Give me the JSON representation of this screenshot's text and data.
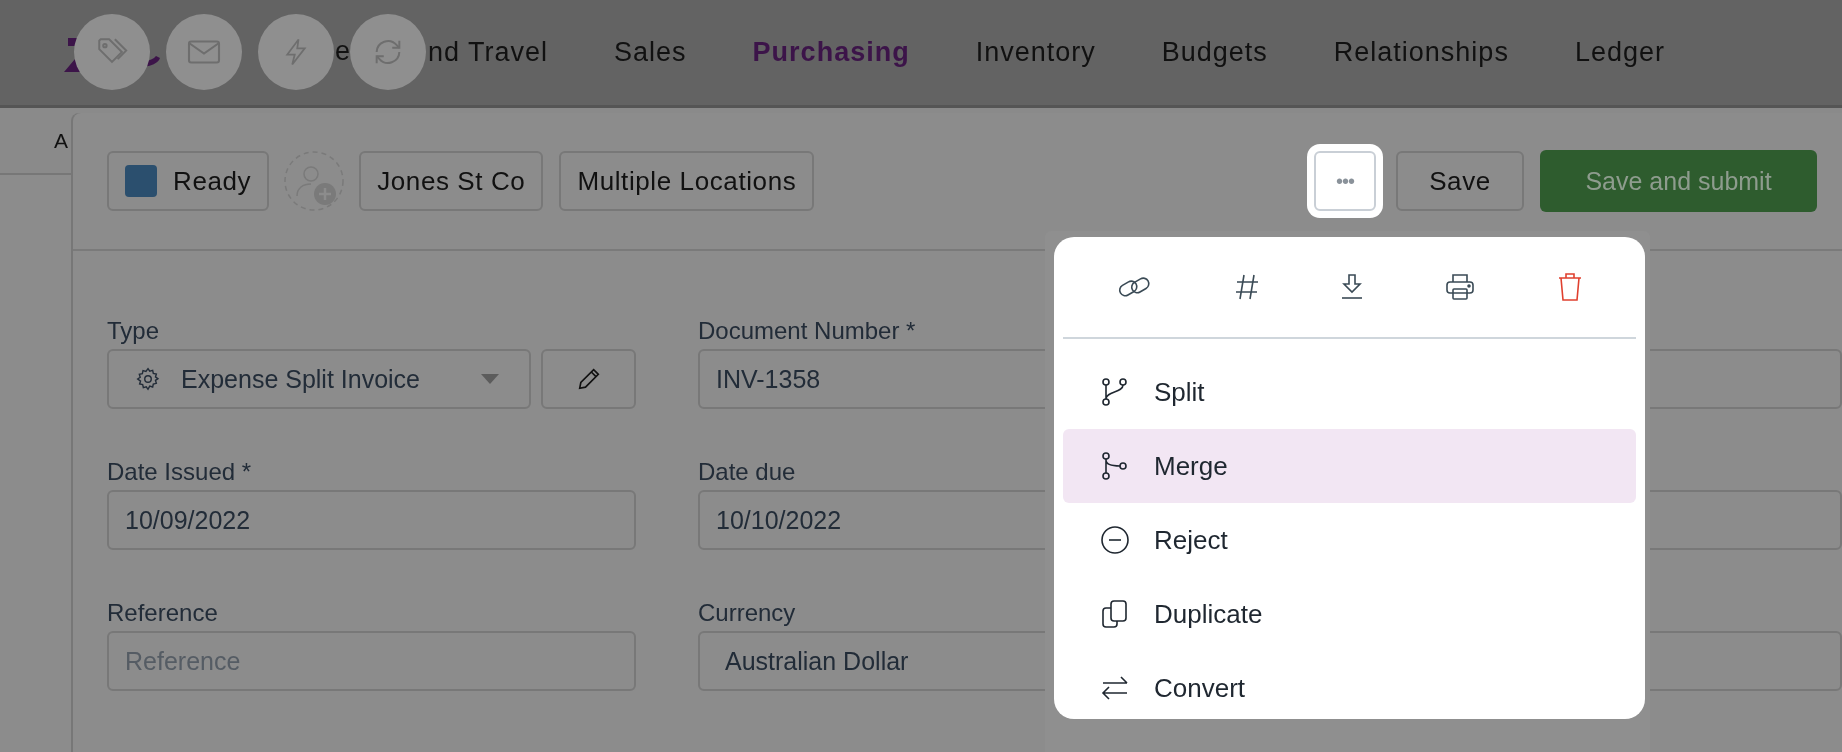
{
  "nav": {
    "covered_fragment": "e",
    "items": [
      {
        "label": "nd Travel",
        "selected": false
      },
      {
        "label": "Sales",
        "selected": false
      },
      {
        "label": "Purchasing",
        "selected": true
      },
      {
        "label": "Inventory",
        "selected": false
      },
      {
        "label": "Budgets",
        "selected": false
      },
      {
        "label": "Relationships",
        "selected": false
      },
      {
        "label": "Ledger",
        "selected": false
      }
    ]
  },
  "floating_actions": [
    {
      "kind": "tag"
    },
    {
      "kind": "mail"
    },
    {
      "kind": "bolt"
    },
    {
      "kind": "refresh"
    }
  ],
  "subnav": {
    "label": "A"
  },
  "header": {
    "status": {
      "label": "Ready",
      "color": "#2b4f6e"
    },
    "chips": [
      "Jones St Co",
      "Multiple Locations"
    ],
    "actions": [
      {
        "kind": "more",
        "label": "•••"
      },
      {
        "kind": "secondary",
        "label": "Save"
      },
      {
        "kind": "primary",
        "label": "Save and submit"
      }
    ]
  },
  "form": {
    "fields": [
      {
        "label": "Type",
        "kind": "select",
        "value": "Expense Split Invoice"
      },
      {
        "label": "Document Number *",
        "kind": "text",
        "value": "INV-1358"
      },
      {
        "label": "Date Issued *",
        "kind": "text",
        "value": "10/09/2022"
      },
      {
        "label": "Date due",
        "kind": "text",
        "value": "10/10/2022"
      },
      {
        "label": "Reference",
        "kind": "text",
        "placeholder": "Reference"
      },
      {
        "label": "Currency",
        "kind": "select-plain",
        "value": "Australian Dollar"
      }
    ]
  },
  "menu": {
    "quick_actions": [
      {
        "kind": "link"
      },
      {
        "kind": "number"
      },
      {
        "kind": "download"
      },
      {
        "kind": "print"
      },
      {
        "kind": "delete"
      }
    ],
    "items": [
      {
        "label": "Split",
        "kind": "split",
        "selected": false
      },
      {
        "label": "Merge",
        "kind": "merge",
        "selected": true
      },
      {
        "label": "Reject",
        "kind": "reject",
        "selected": false
      },
      {
        "label": "Duplicate",
        "kind": "duplicate",
        "selected": false
      },
      {
        "label": "Convert",
        "kind": "convert",
        "selected": false
      }
    ]
  }
}
